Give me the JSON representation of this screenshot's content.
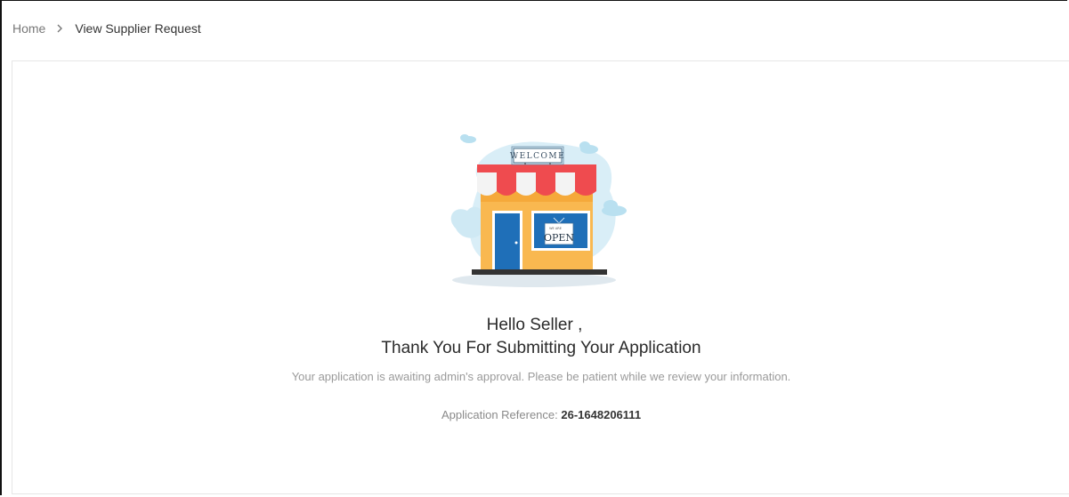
{
  "breadcrumb": {
    "home": "Home",
    "current": "View Supplier Request"
  },
  "illustration": {
    "sign_text": "WELCOME",
    "door_sign_small": "WE ARE",
    "door_sign_text": "OPEN",
    "colors": {
      "awning_red": "#ef4b4f",
      "awning_white": "#f3f3f3",
      "wall_orange": "#f9b850",
      "door_blue": "#1f6fb8",
      "cloud_blue": "#cfe9f4"
    }
  },
  "main": {
    "greeting": "Hello Seller ,",
    "title": "Thank You For Submitting Your Application",
    "message": "Your application is awaiting admin's approval. Please be patient while we review your information.",
    "reference_label": "Application Reference:",
    "reference_value": "26-1648206111"
  }
}
